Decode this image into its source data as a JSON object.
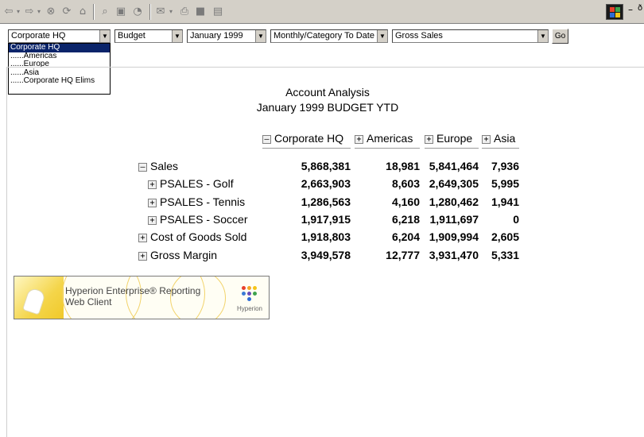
{
  "toolbar": {
    "buttons": [
      "back",
      "forward",
      "stop",
      "refresh",
      "home",
      "search",
      "favorites",
      "history",
      "mail",
      "print",
      "edit",
      "discuss"
    ],
    "window_controls": [
      "–",
      "ð"
    ]
  },
  "selectors": {
    "entity": "Corporate HQ",
    "scenario": "Budget",
    "period": "January 1999",
    "view": "Monthly/Category To Date",
    "account": "Gross Sales",
    "go_label": "Go"
  },
  "entity_dropdown": {
    "options": [
      "Corporate HQ",
      "......Americas",
      "......Europe",
      "......Asia",
      "......Corporate HQ Elims"
    ],
    "selected_index": 0
  },
  "report": {
    "title": "Account Analysis",
    "subtitle": "January 1999 BUDGET YTD",
    "columns": [
      {
        "label": "Corporate HQ",
        "toggle": "–"
      },
      {
        "label": "Americas",
        "toggle": "+"
      },
      {
        "label": "Europe",
        "toggle": "+"
      },
      {
        "label": "Asia",
        "toggle": "+"
      }
    ],
    "rows": [
      {
        "label": "Sales",
        "toggle": "–",
        "values": [
          "5,868,381",
          "18,981",
          "5,841,464",
          "7,936"
        ]
      },
      {
        "label": "PSALES - Golf",
        "toggle": "+",
        "values": [
          "2,663,903",
          "8,603",
          "2,649,305",
          "5,995"
        ]
      },
      {
        "label": "PSALES - Tennis",
        "toggle": "+",
        "values": [
          "1,286,563",
          "4,160",
          "1,280,462",
          "1,941"
        ]
      },
      {
        "label": "PSALES - Soccer",
        "toggle": "+",
        "values": [
          "1,917,915",
          "6,218",
          "1,911,697",
          "0"
        ]
      },
      {
        "label": "Cost of Goods Sold",
        "toggle": "+",
        "values": [
          "1,918,803",
          "6,204",
          "1,909,994",
          "2,605"
        ]
      },
      {
        "label": "Gross Margin",
        "toggle": "+",
        "values": [
          "3,949,578",
          "12,777",
          "3,931,470",
          "5,331"
        ]
      }
    ]
  },
  "banner": {
    "line1": "Hyperion Enterprise® Reporting",
    "line2": "Web Client",
    "logo_label": "Hyperion"
  },
  "colors": {
    "chrome": "#d4d0c8",
    "selection": "#0a246a",
    "banner_yellow": "#f0c92a"
  }
}
